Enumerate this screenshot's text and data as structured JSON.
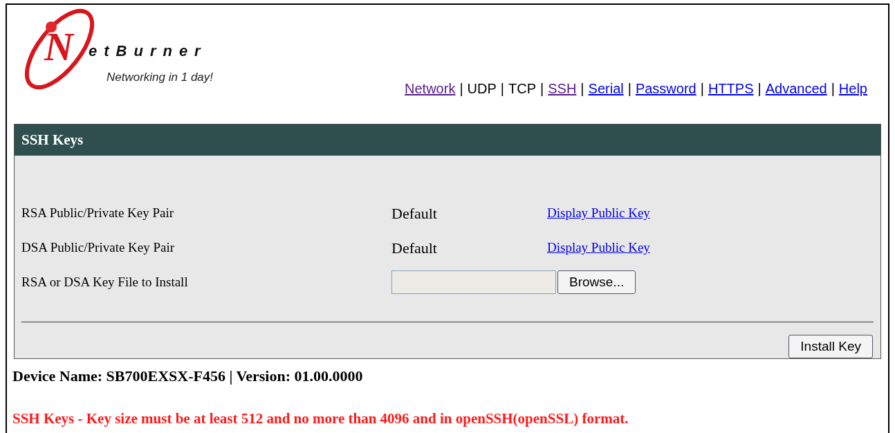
{
  "logo": {
    "letter": "N",
    "wordmark": "etBurner",
    "tagline": "Networking in 1 day!"
  },
  "nav": [
    {
      "label": "Network",
      "kind": "link",
      "visited": true
    },
    {
      "label": "UDP",
      "kind": "text",
      "visited": false
    },
    {
      "label": "TCP",
      "kind": "text",
      "visited": false
    },
    {
      "label": "SSH",
      "kind": "link",
      "visited": true
    },
    {
      "label": "Serial",
      "kind": "link",
      "visited": false
    },
    {
      "label": "Password",
      "kind": "link",
      "visited": false
    },
    {
      "label": "HTTPS",
      "kind": "link",
      "visited": false
    },
    {
      "label": "Advanced",
      "kind": "link",
      "visited": false
    },
    {
      "label": "Help",
      "kind": "link",
      "visited": false
    }
  ],
  "nav_separator": "|",
  "panel": {
    "title": "SSH Keys",
    "rows": [
      {
        "kind": "key",
        "label": "RSA Public/Private Key Pair",
        "value": "Default",
        "link": "Display Public Key"
      },
      {
        "kind": "key",
        "label": "DSA Public/Private Key Pair",
        "value": "Default",
        "link": "Display Public Key"
      },
      {
        "kind": "file",
        "label": "RSA or DSA Key File to Install",
        "button": "Browse..."
      }
    ],
    "submit": "Install Key"
  },
  "footer": "Device Name: SB700EXSX-F456 | Version: 01.00.0000",
  "message": "SSH Keys - Key size must be at least 512 and no more than 4096 and in openSSH(openSSL) format."
}
